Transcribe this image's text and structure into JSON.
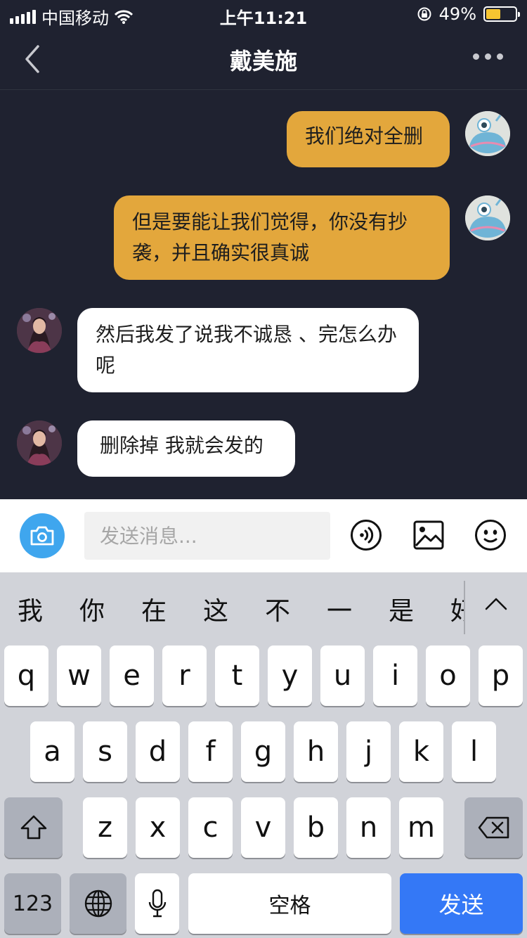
{
  "status_bar": {
    "carrier": "中国移动",
    "time": "上午11:21",
    "battery": "49%",
    "battery_level": 0.49
  },
  "nav": {
    "title": "戴美施"
  },
  "messages": [
    {
      "sender": "me",
      "text": "我们绝对全删"
    },
    {
      "sender": "me",
      "text": "但是要能让我们觉得，你没有抄袭，并且确实很真诚"
    },
    {
      "sender": "other",
      "text": "然后我发了说我不诚恳 、完怎么办呢"
    },
    {
      "sender": "other",
      "text": "删除掉 我就会发的"
    }
  ],
  "input": {
    "placeholder": "发送消息..."
  },
  "keyboard": {
    "suggestions": [
      "我",
      "你",
      "在",
      "这",
      "不",
      "一",
      "是",
      "好"
    ],
    "row1": [
      "q",
      "w",
      "e",
      "r",
      "t",
      "y",
      "u",
      "i",
      "o",
      "p"
    ],
    "row2": [
      "a",
      "s",
      "d",
      "f",
      "g",
      "h",
      "j",
      "k",
      "l"
    ],
    "row3": [
      "z",
      "x",
      "c",
      "v",
      "b",
      "n",
      "m"
    ],
    "numbers_label": "123",
    "space_label": "空格",
    "send_label": "发送"
  },
  "colors": {
    "background": "#1f2230",
    "outgoing_bubble": "#e3a73c",
    "incoming_bubble": "#ffffff",
    "camera_button": "#3fa6ee",
    "send_key": "#3478f6"
  }
}
